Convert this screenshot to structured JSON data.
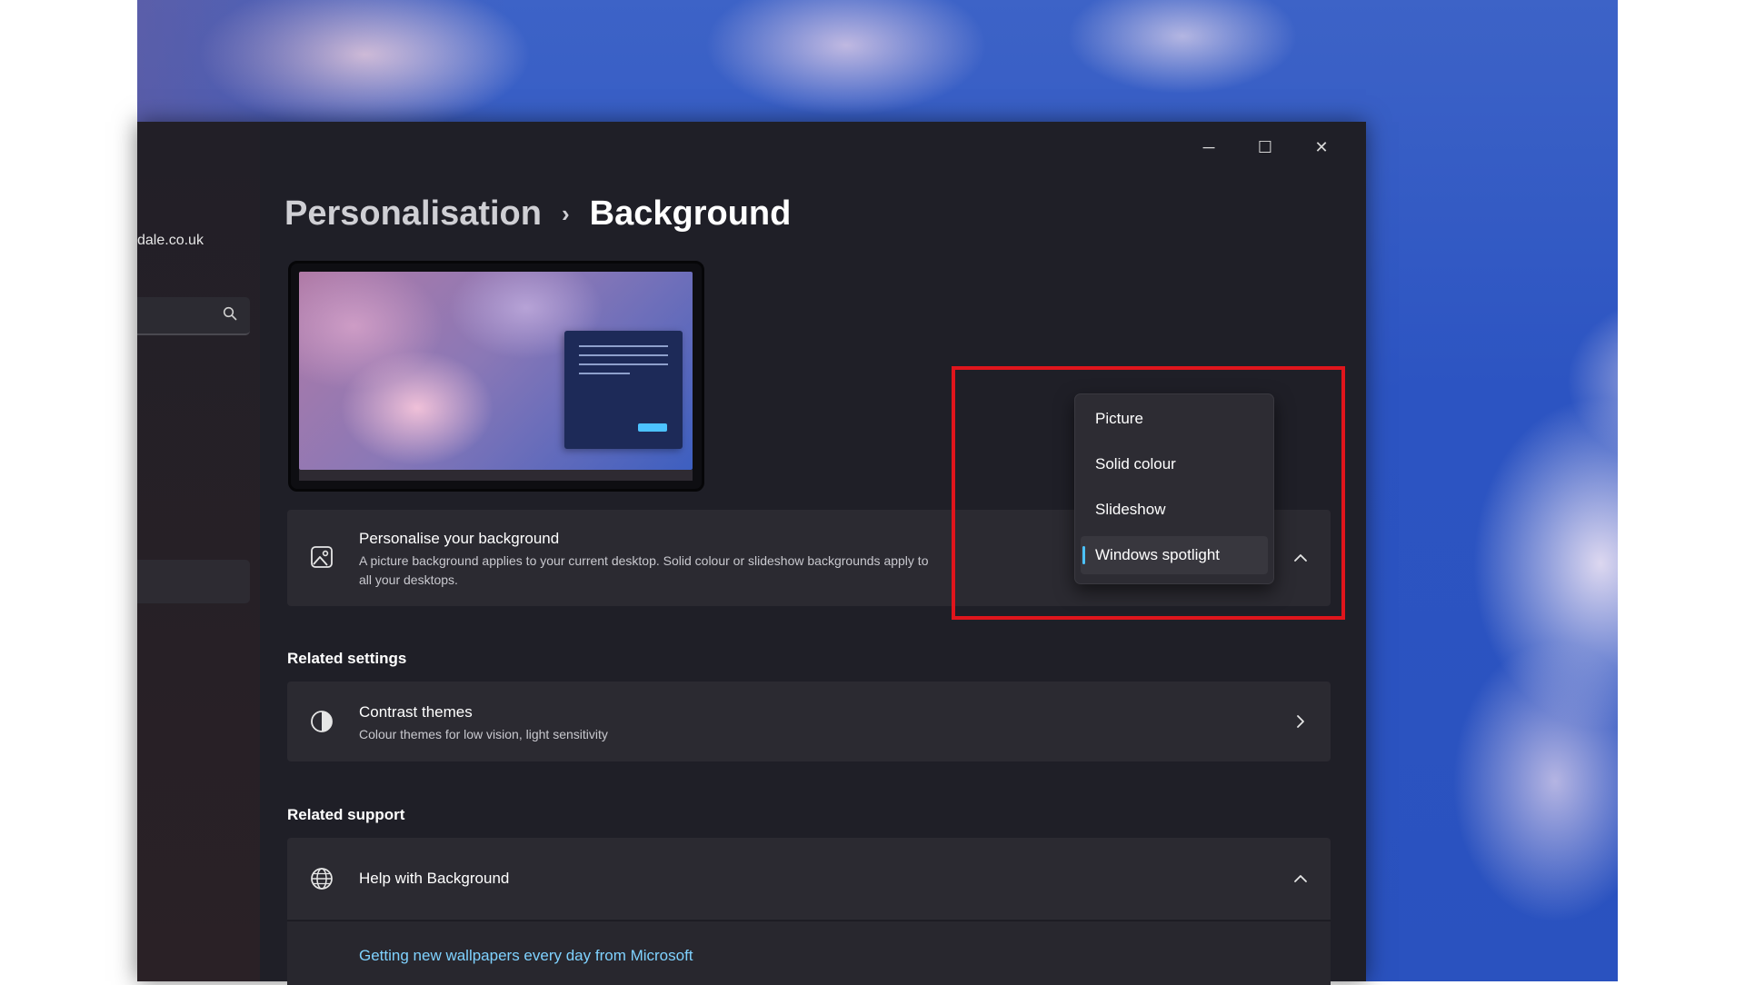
{
  "window": {
    "controls": {
      "minimize": "─",
      "maximize": "☐",
      "close": "✕"
    }
  },
  "sidebar": {
    "account_email": "dale.co.uk"
  },
  "breadcrumb": {
    "parent": "Personalisation",
    "separator": "›",
    "current": "Background"
  },
  "personalise": {
    "title": "Personalise your background",
    "description_line1": "A picture background applies to your current desktop. Solid colour or slideshow backgrou",
    "description_line1_tail": "nds apply to",
    "description_line2": "all your desktops."
  },
  "dropdown": {
    "options": [
      "Picture",
      "Solid colour",
      "Slideshow",
      "Windows spotlight"
    ],
    "selected": "Windows spotlight"
  },
  "related_settings": {
    "heading": "Related settings",
    "contrast": {
      "title": "Contrast themes",
      "description": "Colour themes for low vision, light sensitivity"
    }
  },
  "related_support": {
    "heading": "Related support",
    "help": {
      "title": "Help with Background",
      "link": "Getting new wallpapers every day from Microsoft"
    }
  },
  "colors": {
    "accent": "#4cc2ff",
    "highlight": "#e0151c",
    "window_bg": "#1f1f27",
    "card_bg": "#2b2a31"
  }
}
